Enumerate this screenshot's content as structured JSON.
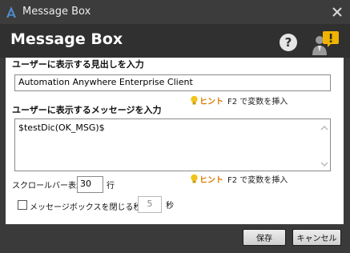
{
  "window": {
    "title": "Message Box",
    "icon": "automation-anywhere-logo-icon",
    "close_icon": "close-x-icon"
  },
  "header": {
    "heading": "Message Box",
    "help_icon": "help-question-icon",
    "user_icon": "user-alert-icon"
  },
  "heading_field": {
    "label": "ユーザーに表示する見出しを入力",
    "value": "Automation Anywhere Enterprise Client"
  },
  "hint_1": {
    "word": "ヒント",
    "text": "F2 で変数を挿入"
  },
  "message_field": {
    "label": "ユーザーに表示するメッセージを入力",
    "value": "$testDic(OK_MSG)$"
  },
  "scrollbar": {
    "label": "スクロールバー表示",
    "value": "30",
    "unit": "行"
  },
  "hint_2": {
    "word": "ヒント",
    "text": "F2 で変数を挿入"
  },
  "auto_close": {
    "label": "メッセージボックスを閉じる秒数",
    "checked": false,
    "value": "5",
    "unit": "秒"
  },
  "buttons": {
    "save": "保存",
    "cancel": "キャンセル"
  },
  "colors": {
    "hint_accent": "#e07a00",
    "bulb": "#f0c419",
    "alert_badge": "#f0b400",
    "title_bg": "#3c3c3c"
  }
}
